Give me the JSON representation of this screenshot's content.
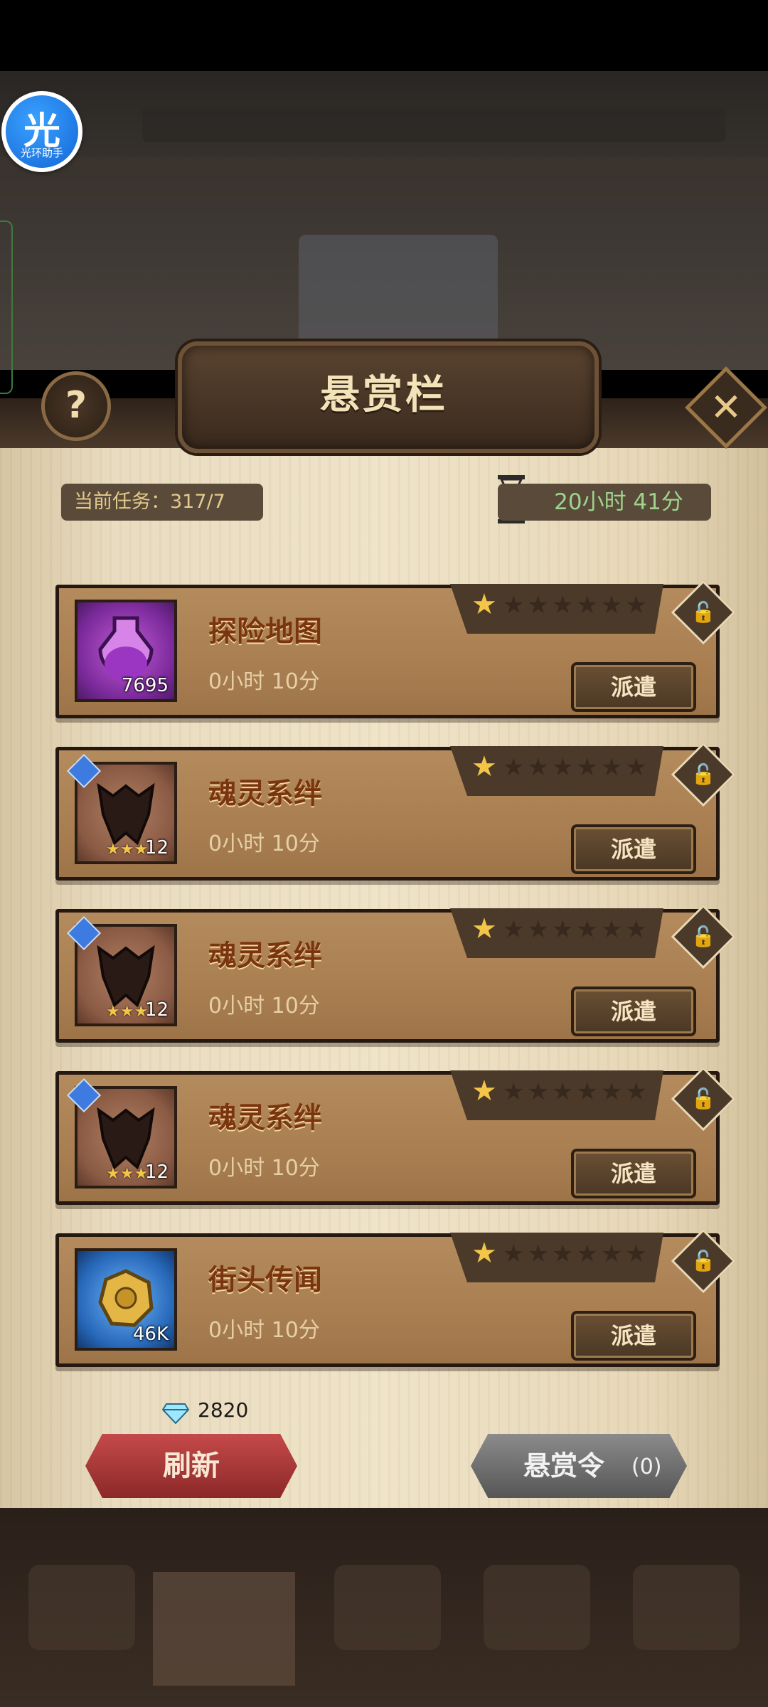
{
  "assistant": {
    "glyph": "光",
    "label": "光环助手"
  },
  "header": {
    "title": "悬赏栏",
    "help": "?",
    "close": "✕"
  },
  "status": {
    "current_task": "当前任务：317/7",
    "timer": "20小时 41分"
  },
  "bounties": [
    {
      "name": "探险地图",
      "time": "0小时 10分",
      "count": "7695",
      "icon": "potion-icon",
      "frame": "purple",
      "stars": 1,
      "dispatch": "派遣"
    },
    {
      "name": "魂灵系绊",
      "time": "0小时 10分",
      "count": "12",
      "icon": "soul-bond-icon",
      "frame": "brown",
      "stars": 1,
      "dispatch": "派遣"
    },
    {
      "name": "魂灵系绊",
      "time": "0小时 10分",
      "count": "12",
      "icon": "soul-bond-icon",
      "frame": "brown",
      "stars": 1,
      "dispatch": "派遣"
    },
    {
      "name": "魂灵系绊",
      "time": "0小时 10分",
      "count": "12",
      "icon": "soul-bond-icon",
      "frame": "brown",
      "stars": 1,
      "dispatch": "派遣"
    },
    {
      "name": "街头传闻",
      "time": "0小时 10分",
      "count": "46K",
      "icon": "coin-icon",
      "frame": "blue",
      "stars": 1,
      "dispatch": "派遣"
    }
  ],
  "actions": {
    "gems": "2820",
    "refresh": "刷新",
    "bounty_token": "悬赏令",
    "bounty_token_count": "(0)"
  },
  "colors": {
    "accent_red": "#c54a4a",
    "parchment": "#efe3c8",
    "name_brown": "#7a3510",
    "timer_green": "#9ed38d"
  }
}
